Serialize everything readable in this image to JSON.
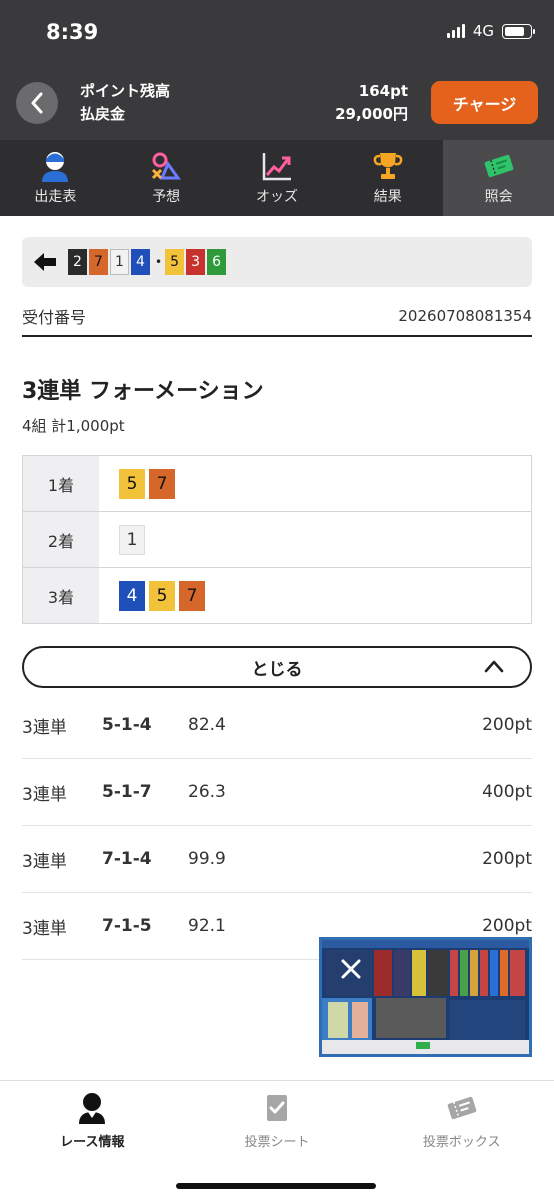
{
  "status_bar": {
    "time": "8:39",
    "network": "4G"
  },
  "header": {
    "point_label": "ポイント残高",
    "refund_label": "払戻金",
    "point_value": "164pt",
    "refund_value": "29,000円",
    "charge_button": "チャージ"
  },
  "tabs": [
    {
      "label": "出走表",
      "icon": "racer-icon"
    },
    {
      "label": "予想",
      "icon": "prediction-icon"
    },
    {
      "label": "オッズ",
      "icon": "odds-chart-icon"
    },
    {
      "label": "結果",
      "icon": "trophy-icon"
    },
    {
      "label": "照会",
      "icon": "ticket-icon",
      "active": true
    }
  ],
  "selection_strip": {
    "numbers": [
      "2",
      "7",
      "1",
      "4",
      "5",
      "3",
      "6"
    ],
    "separator": "•"
  },
  "receipt": {
    "label": "受付番号",
    "value": "20260708081354"
  },
  "bet": {
    "type": "3連単 フォーメーション",
    "summary": "4組 計1,000pt"
  },
  "places": [
    {
      "label": "1着",
      "numbers": [
        "5",
        "7"
      ]
    },
    {
      "label": "2着",
      "numbers": [
        "1"
      ]
    },
    {
      "label": "3着",
      "numbers": [
        "4",
        "5",
        "7"
      ]
    }
  ],
  "close_label": "とじる",
  "combos": [
    {
      "type": "3連単",
      "combo": "5-1-4",
      "odds": "82.4",
      "points": "200pt"
    },
    {
      "type": "3連単",
      "combo": "5-1-7",
      "odds": "26.3",
      "points": "400pt"
    },
    {
      "type": "3連単",
      "combo": "7-1-4",
      "odds": "99.9",
      "points": "200pt"
    },
    {
      "type": "3連単",
      "combo": "7-1-5",
      "odds": "92.1",
      "points": "200pt"
    }
  ],
  "bottom_nav": [
    {
      "label": "レース情報",
      "icon": "racer-icon",
      "active": true
    },
    {
      "label": "投票シート",
      "icon": "vote-sheet-icon"
    },
    {
      "label": "投票ボックス",
      "icon": "ticket-box-icon"
    }
  ],
  "colors": {
    "1": "#f2f2f2",
    "2": "#2b2b2b",
    "3": "#c8322e",
    "4": "#1f4fb8",
    "5": "#f2c33a",
    "6": "#2f9a3a",
    "7": "#d6672a",
    "accent": "#e5621c"
  }
}
